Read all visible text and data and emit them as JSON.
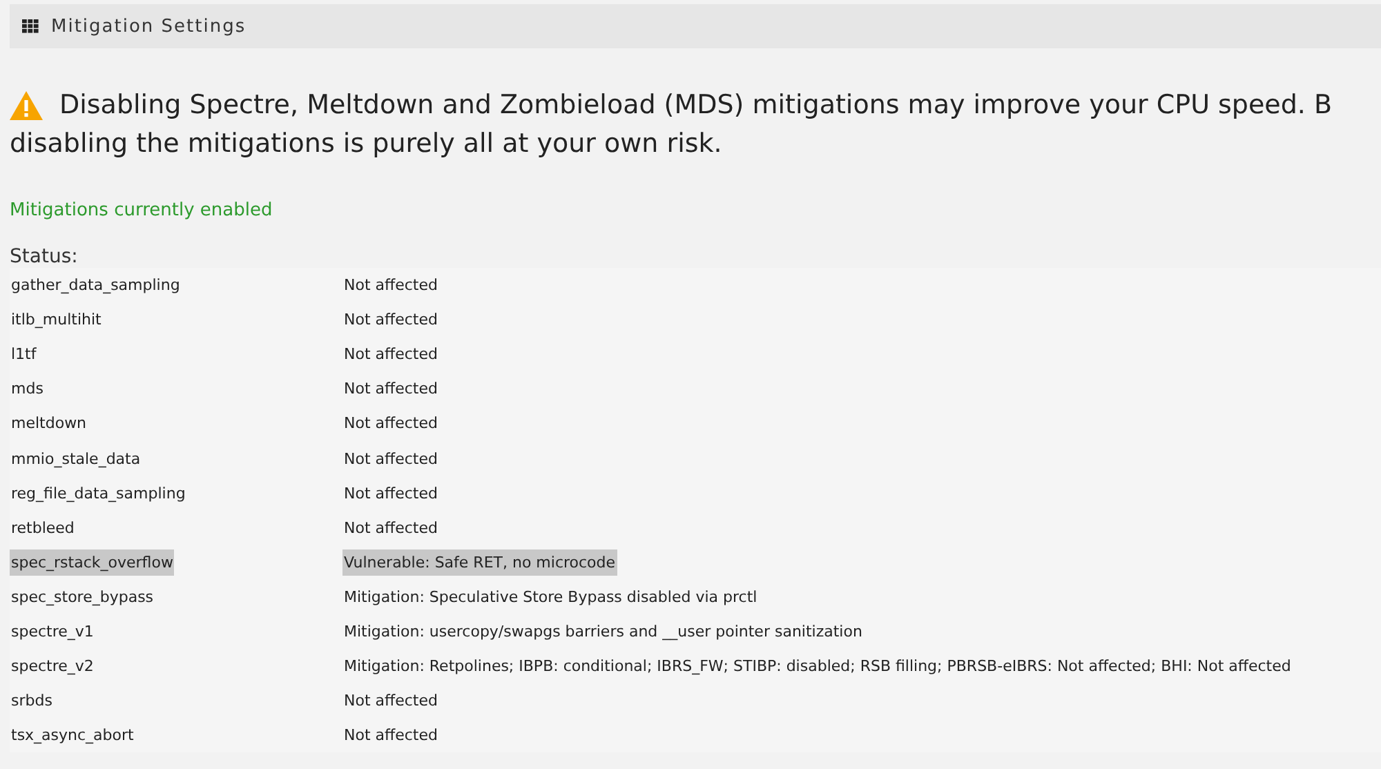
{
  "header": {
    "title": "Mitigation Settings"
  },
  "warning": {
    "lines": [
      "Disabling Spectre, Meltdown and Zombieload (MDS) mitigations may improve your CPU speed. B",
      "disabling the mitigations is purely all at your own risk."
    ]
  },
  "mitigation_state": "Mitigations currently enabled",
  "status": {
    "label": "Status:",
    "rows": [
      {
        "name": "gather_data_sampling",
        "value": "Not affected",
        "highlighted": false
      },
      {
        "name": "itlb_multihit",
        "value": "Not affected",
        "highlighted": false
      },
      {
        "name": "l1tf",
        "value": "Not affected",
        "highlighted": false
      },
      {
        "name": "mds",
        "value": "Not affected",
        "highlighted": false
      },
      {
        "name": "meltdown",
        "value": "Not affected",
        "highlighted": false
      },
      {
        "name": "mmio_stale_data",
        "value": "Not affected",
        "highlighted": false
      },
      {
        "name": "reg_file_data_sampling",
        "value": "Not affected",
        "highlighted": false
      },
      {
        "name": "retbleed",
        "value": "Not affected",
        "highlighted": false
      },
      {
        "name": "spec_rstack_overflow",
        "value": "Vulnerable: Safe RET, no microcode",
        "highlighted": true
      },
      {
        "name": "spec_store_bypass",
        "value": "Mitigation: Speculative Store Bypass disabled via prctl",
        "highlighted": false
      },
      {
        "name": "spectre_v1",
        "value": "Mitigation: usercopy/swapgs barriers and __user pointer sanitization",
        "highlighted": false
      },
      {
        "name": "spectre_v2",
        "value": "Mitigation: Retpolines; IBPB: conditional; IBRS_FW; STIBP: disabled; RSB filling; PBRSB-eIBRS: Not affected; BHI: Not affected",
        "highlighted": false
      },
      {
        "name": "srbds",
        "value": "Not affected",
        "highlighted": false
      },
      {
        "name": "tsx_async_abort",
        "value": "Not affected",
        "highlighted": false
      }
    ]
  }
}
